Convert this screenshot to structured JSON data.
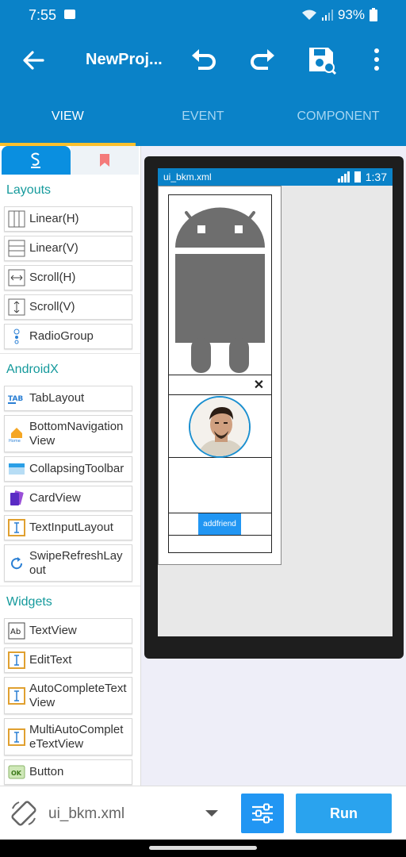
{
  "status_bar": {
    "time": "7:55",
    "battery": "93%"
  },
  "app_bar": {
    "title": "NewProj..."
  },
  "tabs": [
    {
      "label": "VIEW",
      "active": true
    },
    {
      "label": "EVENT",
      "active": false
    },
    {
      "label": "COMPONENT",
      "active": false
    }
  ],
  "palette": {
    "sections": {
      "layouts": "Layouts",
      "androidx": "AndroidX",
      "widgets": "Widgets"
    },
    "layouts": [
      "Linear(H)",
      "Linear(V)",
      "Scroll(H)",
      "Scroll(V)",
      "RadioGroup"
    ],
    "androidx": [
      "TabLayout",
      "BottomNavigation View",
      "CollapsingToolbar",
      "CardView",
      "TextInputLayout",
      "SwipeRefreshLay out"
    ],
    "widgets": [
      "TextView",
      "EditText",
      "AutoCompleteText View",
      "MultiAutoComplet eTextView",
      "Button"
    ]
  },
  "preview": {
    "file_label": "ui_bkm.xml",
    "clock": "1:37",
    "close_glyph": "✕",
    "button_text": "addfriend"
  },
  "bottom_bar": {
    "file_name": "ui_bkm.xml",
    "run_label": "Run"
  },
  "colors": {
    "primary": "#0a82c8",
    "accent": "#fbc02d",
    "section_text": "#159a9c",
    "run_button": "#2aa3ee"
  }
}
